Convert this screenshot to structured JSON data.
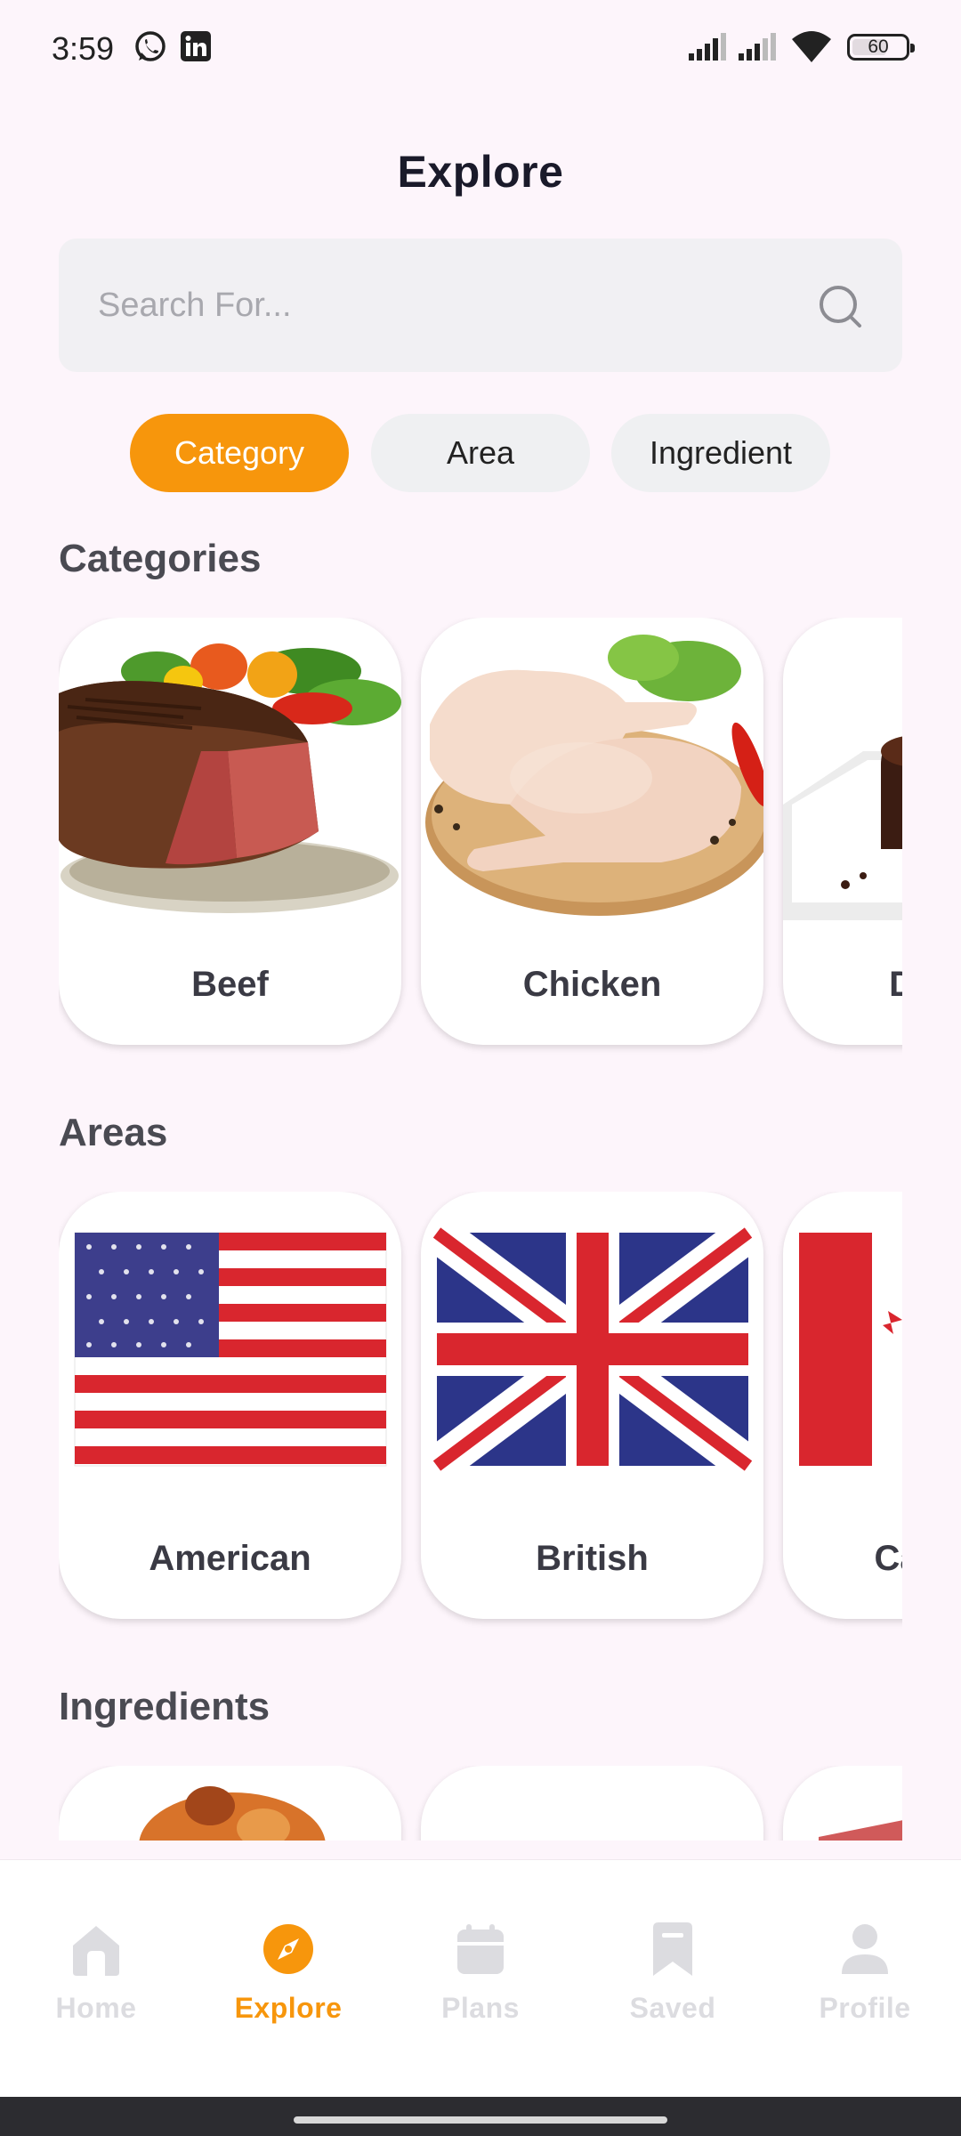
{
  "status_bar": {
    "time": "3:59",
    "battery": "60"
  },
  "header": {
    "title": "Explore"
  },
  "search": {
    "placeholder": "Search For..."
  },
  "filters": {
    "chips": [
      {
        "label": "Category",
        "active": true
      },
      {
        "label": "Area",
        "active": false
      },
      {
        "label": "Ingredient",
        "active": false
      }
    ]
  },
  "categories": {
    "title": "Categories",
    "items": [
      {
        "label": "Beef"
      },
      {
        "label": "Chicken"
      },
      {
        "label": "Dessert"
      }
    ]
  },
  "areas": {
    "title": "Areas",
    "items": [
      {
        "label": "American"
      },
      {
        "label": "British"
      },
      {
        "label": "Canadian"
      }
    ]
  },
  "ingredients": {
    "title": "Ingredients"
  },
  "bottom_nav": {
    "items": [
      {
        "label": "Home",
        "icon": "home-icon",
        "active": false
      },
      {
        "label": "Explore",
        "icon": "compass-icon",
        "active": true
      },
      {
        "label": "Plans",
        "icon": "calendar-icon",
        "active": false
      },
      {
        "label": "Saved",
        "icon": "bookmark-icon",
        "active": false
      },
      {
        "label": "Profile",
        "icon": "person-icon",
        "active": false
      }
    ]
  },
  "colors": {
    "accent": "#F7960C",
    "background": "#FDF5FB",
    "chip_inactive": "#EFF0F2"
  }
}
